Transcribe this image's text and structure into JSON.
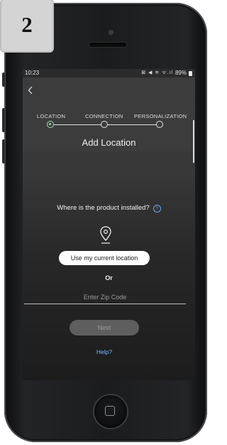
{
  "badge": {
    "step_number": "2"
  },
  "status_bar": {
    "time": "10:23",
    "icons": "⊠ ◀ ≋ ᯤ.ıl",
    "battery": "89%"
  },
  "header": {
    "back_icon": "back-arrow-icon",
    "steps": [
      {
        "label": "LOCATION",
        "state": "active"
      },
      {
        "label": "CONNECTION",
        "state": "inactive"
      },
      {
        "label": "PERSONALIZATION",
        "state": "inactive"
      }
    ],
    "title": "Add Location"
  },
  "main": {
    "question": "Where is the product installed?",
    "question_help_icon": "question-circle-icon",
    "location_icon": "location-pin-icon",
    "use_location_label": "Use my current location",
    "or_label": "Or",
    "zip_placeholder": "Enter Zip Code",
    "zip_value": "",
    "next_label": "Next",
    "help_label": "Help?"
  },
  "colors": {
    "accent_green": "#9fe3a8",
    "link_blue": "#79b7f5",
    "header_bg": "#3c3c3c"
  }
}
